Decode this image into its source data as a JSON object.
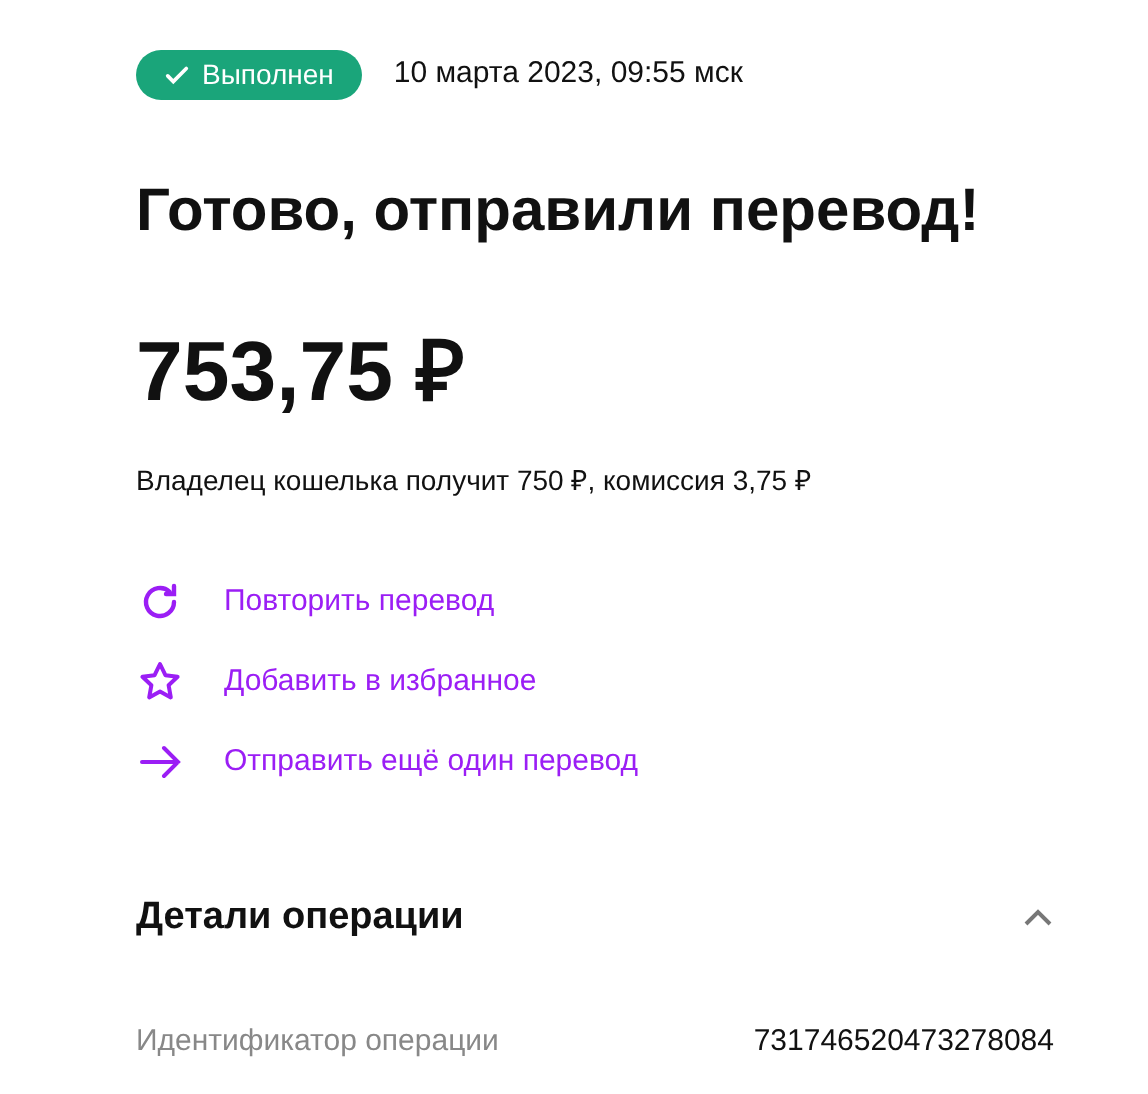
{
  "status": {
    "label": "Выполнен",
    "kind": "done"
  },
  "date": "10 марта 2023, 09:55 мск",
  "title": "Готово, отправили перевод!",
  "amount": "753,75 ₽",
  "description": "Владелец кошелька получит 750 ₽, комиссия 3,75 ₽",
  "actions": [
    {
      "kind": "repeat",
      "label": "Повторить перевод"
    },
    {
      "kind": "favorite",
      "label": "Добавить в избранное"
    },
    {
      "kind": "send",
      "label": "Отправить ещё один перевод"
    }
  ],
  "details": {
    "title": "Детали операции",
    "expanded": true,
    "rows": [
      {
        "label": "Идентификатор операции",
        "value": "731746520473278084"
      }
    ]
  }
}
